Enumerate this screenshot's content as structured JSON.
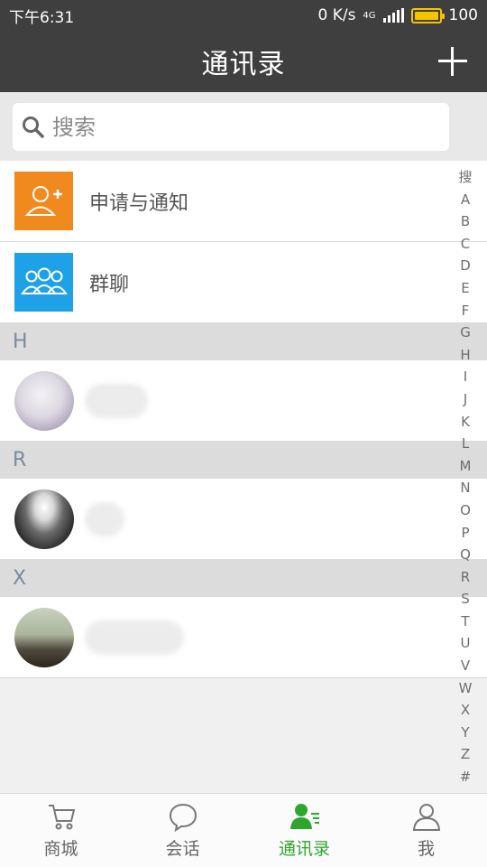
{
  "status": {
    "time": "下午6:31",
    "speed": "0 K/s",
    "network": "4G",
    "battery": "100"
  },
  "header": {
    "title": "通讯录"
  },
  "search": {
    "placeholder": "搜索"
  },
  "actions": [
    {
      "label": "申请与通知",
      "icon": "add-contact-icon",
      "color": "#f08a1e"
    },
    {
      "label": "群聊",
      "icon": "group-icon",
      "color": "#1ea1e6"
    }
  ],
  "sections": [
    {
      "letter": "H"
    },
    {
      "letter": "R"
    },
    {
      "letter": "X"
    }
  ],
  "index": [
    "搜",
    "A",
    "B",
    "C",
    "D",
    "E",
    "F",
    "G",
    "H",
    "I",
    "J",
    "K",
    "L",
    "M",
    "N",
    "O",
    "P",
    "Q",
    "R",
    "S",
    "T",
    "U",
    "V",
    "W",
    "X",
    "Y",
    "Z",
    "#"
  ],
  "nav": [
    {
      "label": "商城",
      "icon": "cart-icon"
    },
    {
      "label": "会话",
      "icon": "chat-bubble-icon"
    },
    {
      "label": "通讯录",
      "icon": "contacts-icon",
      "active": true
    },
    {
      "label": "我",
      "icon": "user-icon"
    }
  ],
  "colors": {
    "header_bg": "#3f3f3f",
    "accent": "#2ea62e",
    "section_bg": "#dcdcdc"
  }
}
